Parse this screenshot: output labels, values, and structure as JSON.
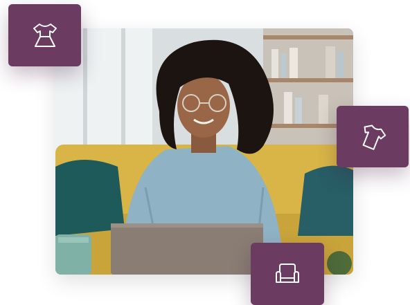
{
  "hero_photo": {
    "alt": "",
    "description_icon": "person-with-laptop"
  },
  "category_tiles": [
    {
      "icon": "dress-icon",
      "color": "#6b3b62"
    },
    {
      "icon": "tshirt-icon",
      "color": "#6b3b62"
    },
    {
      "icon": "armchair-icon",
      "color": "#6b3b62"
    }
  ],
  "colors": {
    "tile_background": "#6b3b62",
    "icon_stroke": "#ffffff",
    "sofa": "#d9b548",
    "cushion": "#1f5a5a",
    "sweater": "#8fb2c4"
  }
}
